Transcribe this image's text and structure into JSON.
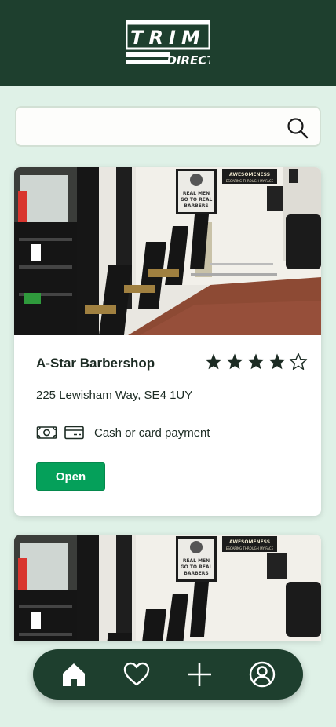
{
  "header": {
    "logo_line1": "TRIM",
    "logo_line2": "DIRECT"
  },
  "search": {
    "placeholder": "",
    "value": ""
  },
  "shops": [
    {
      "name": "A-Star Barbershop",
      "rating": 4,
      "rating_max": 5,
      "address": "225 Lewisham Way, SE4 1UY",
      "payment_icons": [
        "cash-icon",
        "card-icon"
      ],
      "payment_text": "Cash or card payment",
      "status_label": "Open",
      "photo_text": {
        "sign1_line1": "REAL MEN",
        "sign1_line2": "GO TO REAL",
        "sign1_line3": "BARBERS",
        "sign2_line1": "AWESOMENESS",
        "sign2_line2": "ESCAPING THROUGH MY FACE"
      }
    },
    {
      "photo_text": {
        "sign1_line1": "REAL MEN",
        "sign1_line2": "GO TO REAL",
        "sign1_line3": "BARBERS",
        "sign2_line1": "AWESOMENESS",
        "sign2_line2": "ESCAPING THROUGH MY FACE"
      }
    }
  ],
  "nav": {
    "items": [
      "home-icon",
      "heart-icon",
      "plus-icon",
      "profile-icon"
    ],
    "active": "home-icon"
  },
  "colors": {
    "header_bg": "#1e3f2e",
    "page_bg": "#dff1e7",
    "open_green": "#05a05a"
  }
}
